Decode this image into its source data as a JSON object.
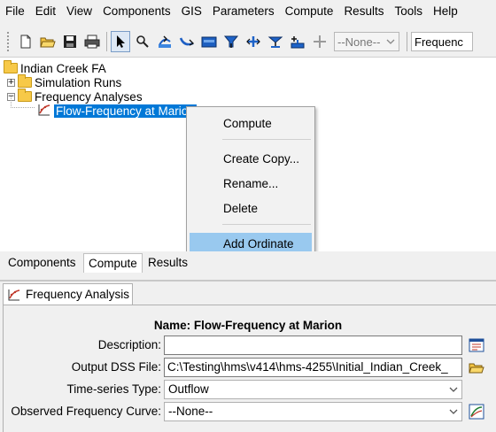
{
  "menu": [
    "File",
    "Edit",
    "View",
    "Components",
    "GIS",
    "Parameters",
    "Compute",
    "Results",
    "Tools",
    "Help"
  ],
  "toolbar": {
    "icons": [
      "new-file-icon",
      "open-folder-icon",
      "save-icon",
      "print-icon",
      "arrow-pointer-icon",
      "zoom-icon",
      "add-subbasin-icon",
      "add-reach-icon",
      "add-reservoir-icon",
      "add-source-icon",
      "add-junction-icon",
      "add-diversion-icon",
      "add-sink-icon",
      "crosshair-icon"
    ],
    "run_combo_value": "--None--",
    "analysis_combo_value": "Frequenc"
  },
  "tree": {
    "root": "Indian Creek FA",
    "simulation_runs": "Simulation Runs",
    "frequency_analyses": "Frequency Analyses",
    "selected_node": "Flow-Frequency at Marion"
  },
  "context_menu": {
    "compute": "Compute",
    "create_copy": "Create Copy...",
    "rename": "Rename...",
    "delete": "Delete",
    "add_ordinate": "Add Ordinate"
  },
  "bottom_tabs": [
    "Components",
    "Compute",
    "Results"
  ],
  "editor": {
    "tab_title": "Frequency Analysis",
    "name_label": "Name:",
    "name_value": "Flow-Frequency at Marion",
    "description_label": "Description:",
    "description_value": "",
    "output_dss_label": "Output DSS File:",
    "output_dss_value": "C:\\Testing\\hms\\v414\\hms-4255\\Initial_Indian_Creek_",
    "ts_type_label": "Time-series Type:",
    "ts_type_value": "Outflow",
    "obs_curve_label": "Observed Frequency Curve:",
    "obs_curve_value": "--None--"
  }
}
